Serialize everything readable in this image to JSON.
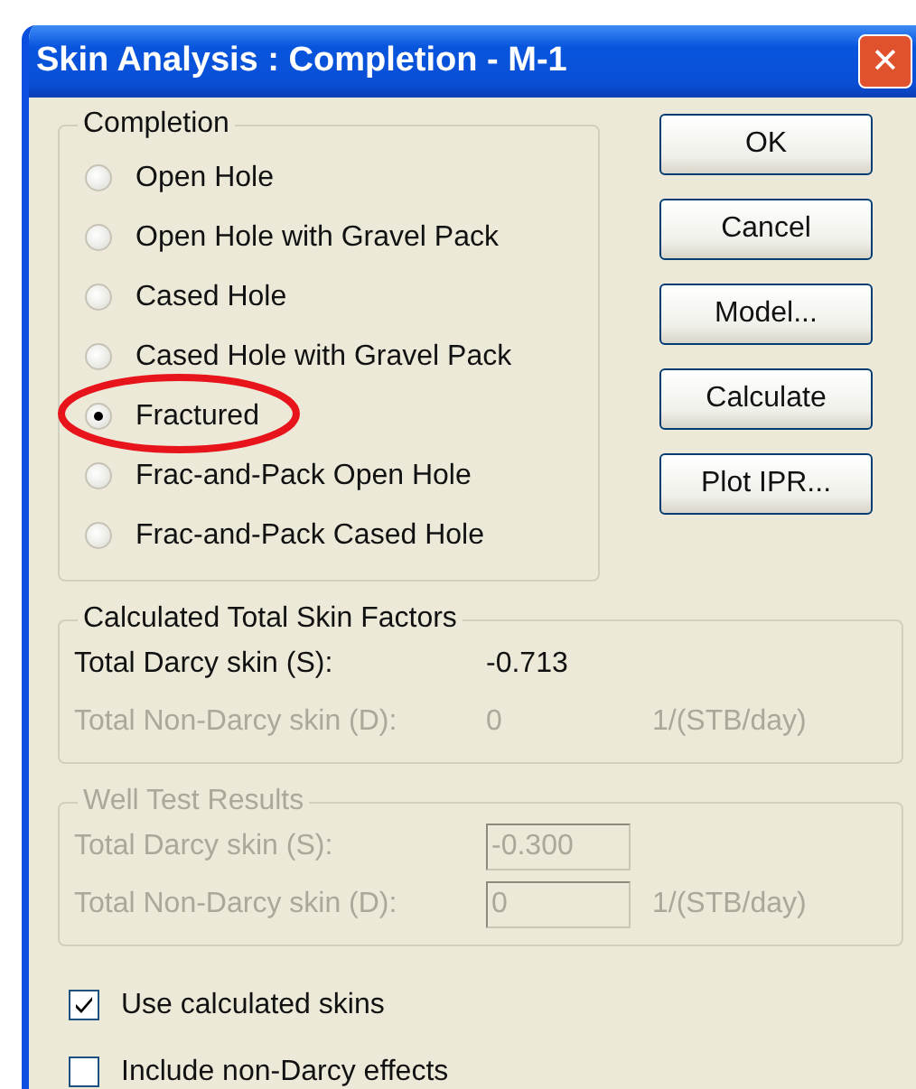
{
  "window": {
    "title": "Skin Analysis : Completion - M-1",
    "close": "✕"
  },
  "completion": {
    "title": "Completion",
    "options": [
      {
        "label": "Open Hole",
        "selected": false,
        "circled": false
      },
      {
        "label": "Open Hole with Gravel Pack",
        "selected": false,
        "circled": false
      },
      {
        "label": "Cased Hole",
        "selected": false,
        "circled": false
      },
      {
        "label": "Cased Hole with Gravel Pack",
        "selected": false,
        "circled": false
      },
      {
        "label": "Fractured",
        "selected": true,
        "circled": true
      },
      {
        "label": "Frac-and-Pack Open Hole",
        "selected": false,
        "circled": false
      },
      {
        "label": "Frac-and-Pack Cased Hole",
        "selected": false,
        "circled": false
      }
    ]
  },
  "buttons": [
    "OK",
    "Cancel",
    "Model...",
    "Calculate",
    "Plot IPR..."
  ],
  "calculated": {
    "title": "Calculated Total Skin Factors",
    "disabled": false,
    "rows": [
      {
        "label": "Total Darcy skin (S):",
        "value": "-0.713",
        "disabled": false
      },
      {
        "label": "Total Non-Darcy skin (D):",
        "value": "0",
        "unit": "1/(STB/day)",
        "disabled": true
      }
    ]
  },
  "well_test": {
    "title": "Well Test Results",
    "disabled": true,
    "rows": [
      {
        "label": "Total Darcy skin (S):",
        "value": "-0.300",
        "disabled": true
      },
      {
        "label": "Total Non-Darcy skin (D):",
        "value": "0",
        "unit": "1/(STB/day)",
        "disabled": true
      }
    ]
  },
  "checkboxes": [
    {
      "label": "Use calculated skins",
      "checked": true
    },
    {
      "label": "Include non-Darcy effects",
      "checked": false
    }
  ]
}
